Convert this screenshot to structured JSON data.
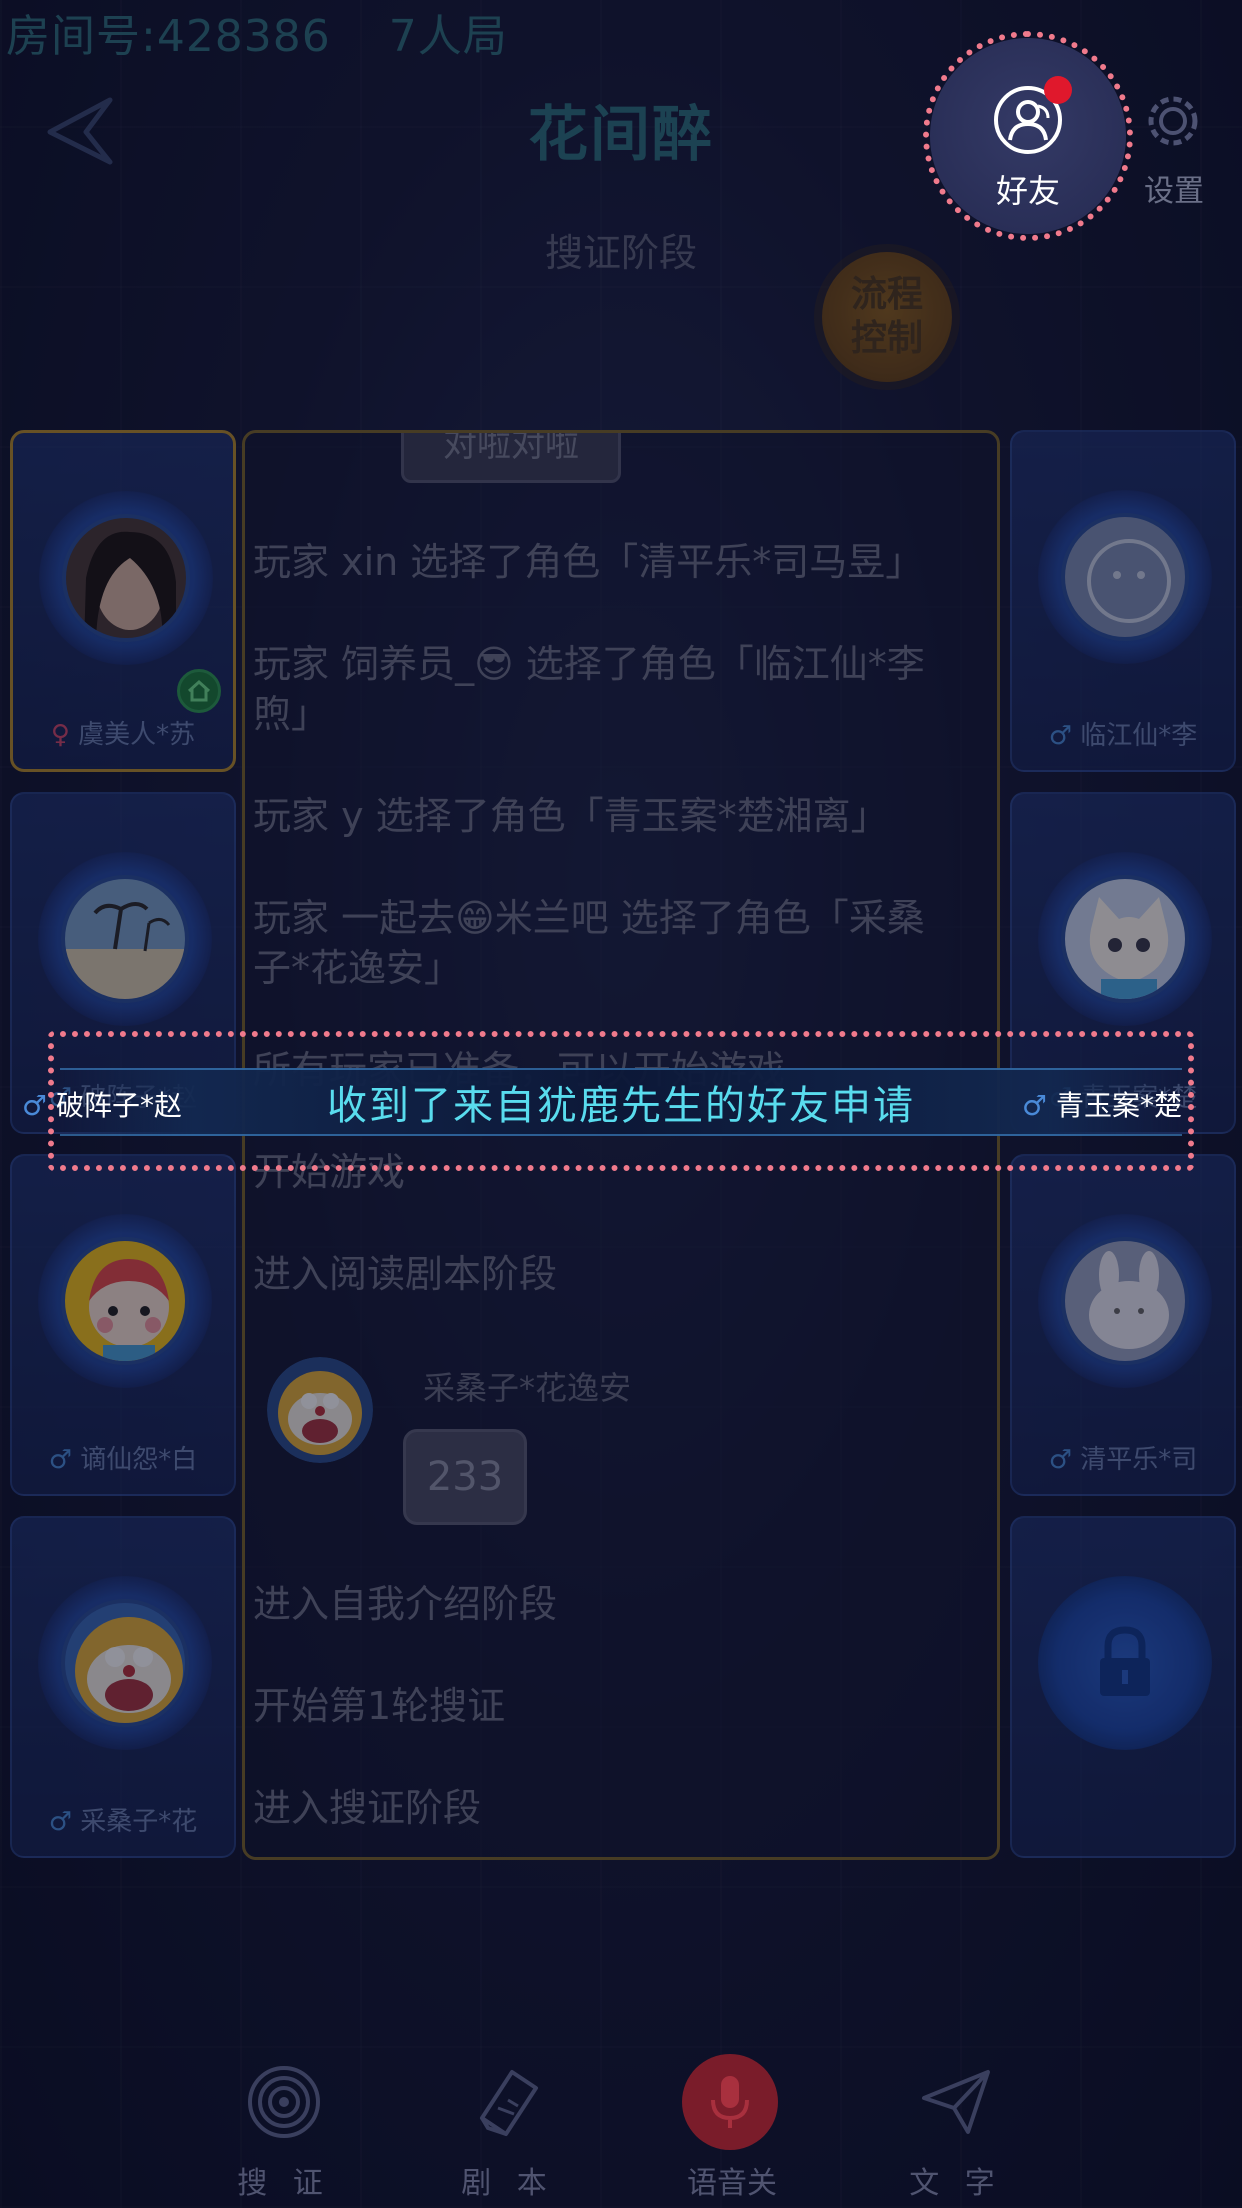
{
  "room": {
    "id_label": "房间号:428386",
    "mode_label": "7人局"
  },
  "header": {
    "title": "花间醉",
    "phase": "搜证阶段",
    "flow_control_label": "流程控制"
  },
  "friends": {
    "label": "好友",
    "has_notification": true
  },
  "settings": {
    "label": "设置"
  },
  "players": [
    {
      "name": "虞美人*苏",
      "gender": "♀",
      "is_host": true
    },
    {
      "name": "临江仙*李",
      "gender": "♂"
    },
    {
      "name": "破阵子*赵",
      "gender": "♂"
    },
    {
      "name": "青玉案*楚",
      "gender": "♂"
    },
    {
      "name": "谪仙怨*白",
      "gender": "♂"
    },
    {
      "name": "清平乐*司",
      "gender": "♂"
    },
    {
      "name": "采桑子*花",
      "gender": "♂"
    },
    {
      "name": "",
      "locked": true
    }
  ],
  "chat": {
    "top_tag": "对啦对啦",
    "messages": [
      "玩家 xin 选择了角色「清平乐*司马昱」",
      "玩家 饲养员_😎 选择了角色「临江仙*李煦」",
      "玩家 y 选择了角色「青玉案*楚湘离」",
      "玩家 一起去😁米兰吧 选择了角色「采桑子*花逸安」",
      "所有玩家已准备，可以开始游戏",
      "开始游戏",
      "进入阅读剧本阶段",
      "进入自我介绍阶段",
      "开始第1轮搜证",
      "进入搜证阶段"
    ],
    "user_message": {
      "sender": "采桑子*花逸安",
      "text": "233"
    }
  },
  "toast": {
    "text": "收到了来自犹鹿先生的好友申请"
  },
  "bottom_tabs": [
    {
      "label": "搜 证",
      "icon": "fingerprint-icon"
    },
    {
      "label": "剧 本",
      "icon": "script-book-icon"
    },
    {
      "label": "语音关",
      "icon": "microphone-icon"
    },
    {
      "label": "文 字",
      "icon": "send-text-icon"
    }
  ],
  "colors": {
    "accent_cyan": "#59dcee",
    "highlight_ring": "#f07a8c",
    "notification_red": "#e0182c",
    "host_border": "#b48a2a"
  }
}
